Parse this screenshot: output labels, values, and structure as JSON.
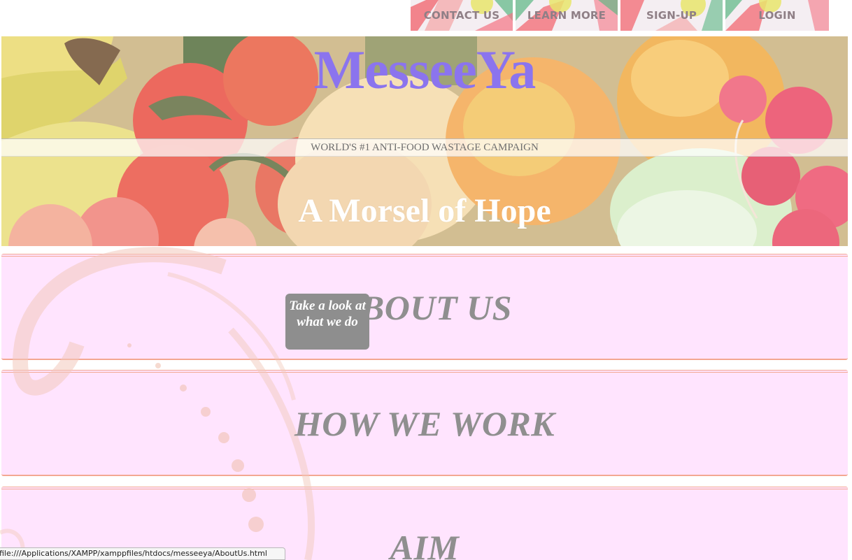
{
  "nav": {
    "items": [
      {
        "label": "CONTACT US"
      },
      {
        "label": "LEARN MORE"
      },
      {
        "label": "SIGN-UP"
      },
      {
        "label": "LOGIN"
      }
    ]
  },
  "hero": {
    "brand": "MesseeYa",
    "tagline": "WORLD'S #1 ANTI-FOOD WASTAGE CAMPAIGN",
    "headline": "A Morsel of Hope"
  },
  "sections": [
    {
      "title": "ABOUT US"
    },
    {
      "title": "HOW WE WORK"
    },
    {
      "title": "AIM"
    }
  ],
  "tooltip": {
    "text": "Take a look at what we do"
  },
  "status": {
    "url": "file:///Applications/XAMPP/xamppfiles/htdocs/messeeya/AboutUs.html"
  },
  "colors": {
    "brand": "#8b74ee",
    "section_bg": "#ffe4fe",
    "section_border": "#f3a792",
    "section_text": "#8f8f8f",
    "nav_text": "#8f7f86",
    "tooltip_bg": "#8e8e8e"
  }
}
